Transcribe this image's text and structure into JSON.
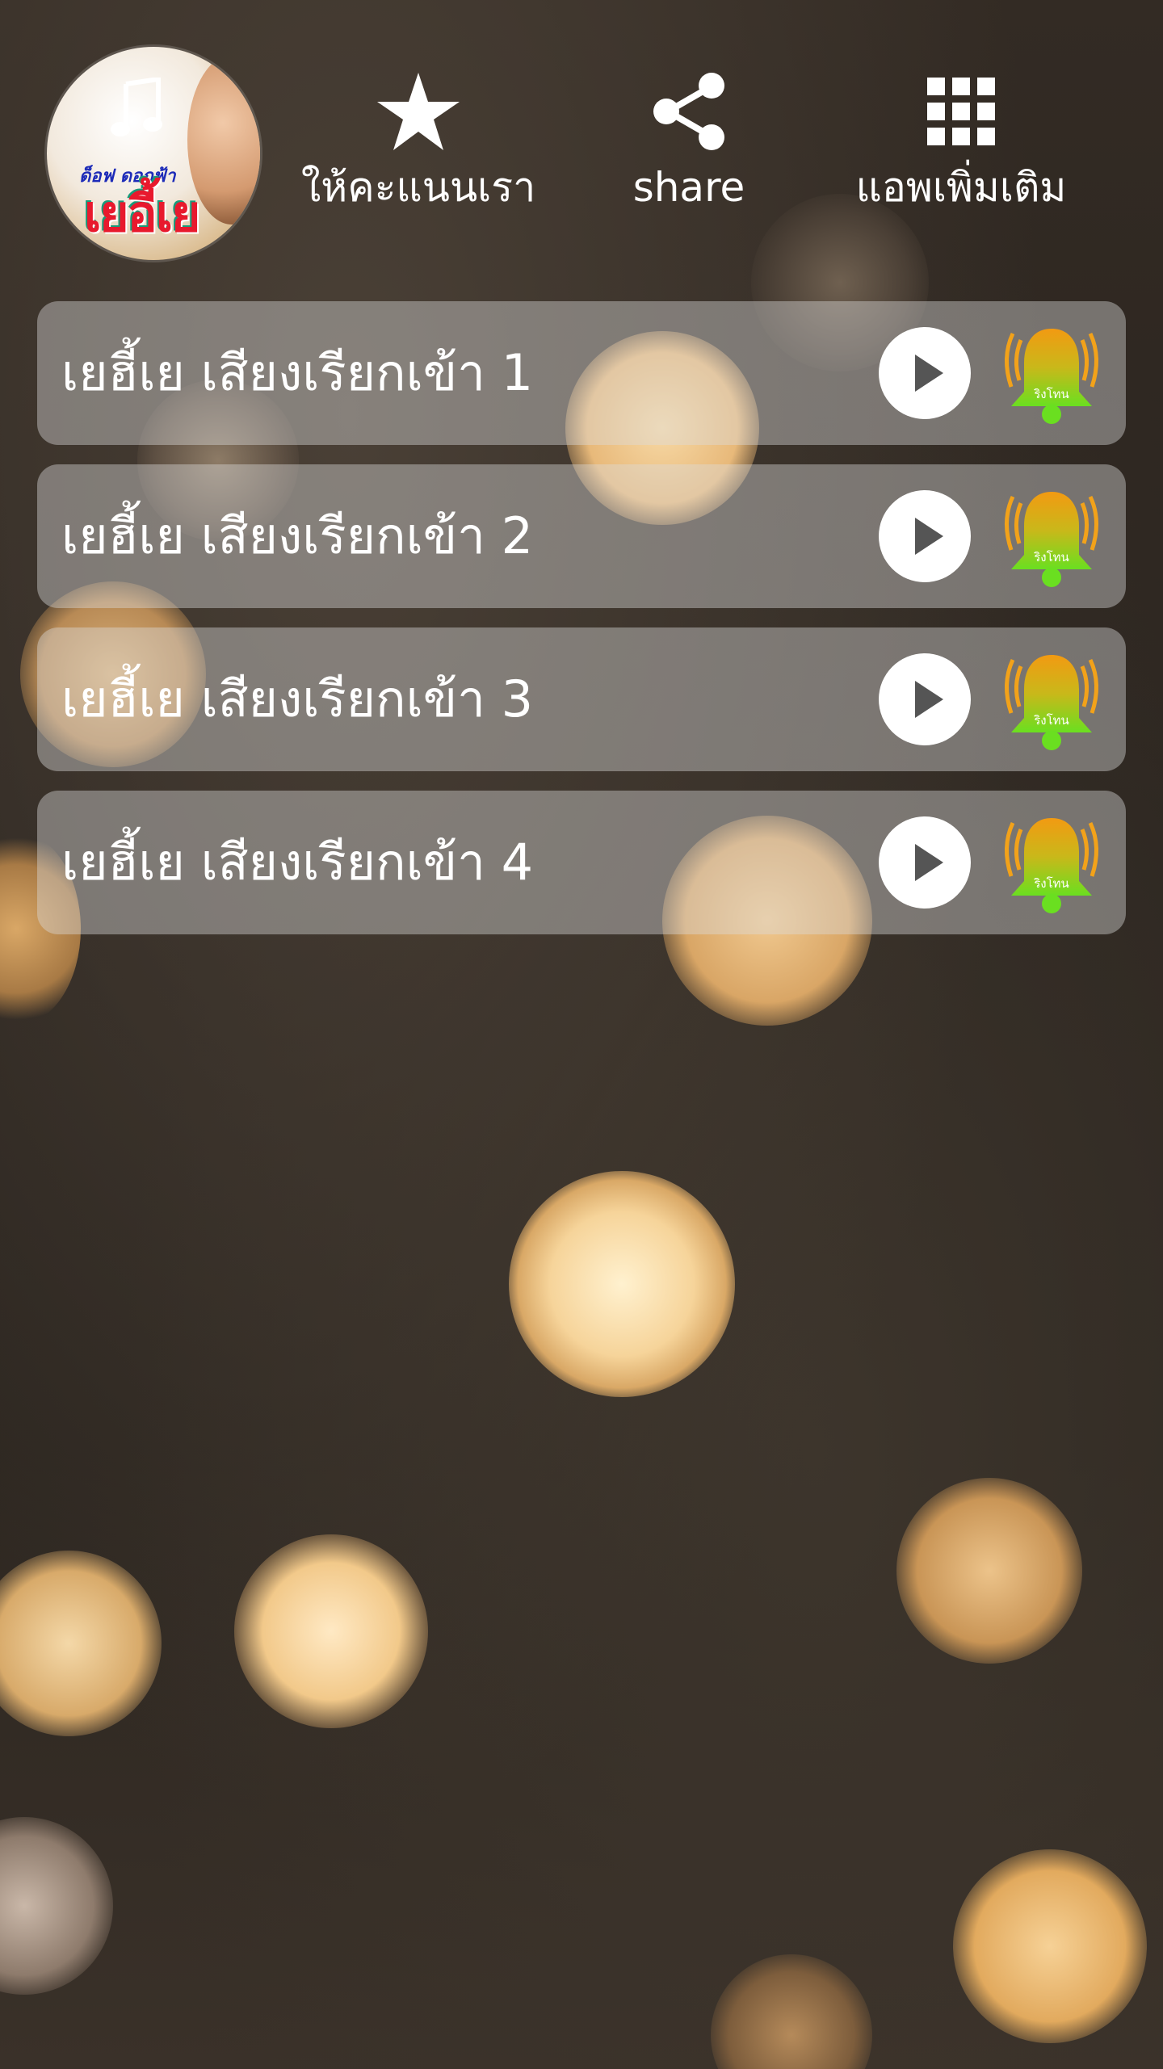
{
  "header": {
    "logo": {
      "small_text": "ด็อฟ ดอกฟ้า",
      "big_text": "เยอี้เย"
    },
    "rate_label": "ให้คะแนนเรา",
    "share_label": "share",
    "more_apps_label": "แอพเพิ่มเติม"
  },
  "ringtones": [
    {
      "title": "เยฮี้เย เสียงเรียกเข้า 1",
      "badge": "ริงโทน"
    },
    {
      "title": "เยฮี้เย เสียงเรียกเข้า 2",
      "badge": "ริงโทน"
    },
    {
      "title": "เยฮี้เย เสียงเรียกเข้า 3",
      "badge": "ริงโทน"
    },
    {
      "title": "เยฮี้เย เสียงเรียกเข้า 4",
      "badge": "ริงโทน"
    }
  ],
  "icons": {
    "rate": "star-icon",
    "share": "share-icon",
    "more_apps": "grid-icon",
    "play": "play-icon",
    "ringtone": "bell-icon"
  }
}
